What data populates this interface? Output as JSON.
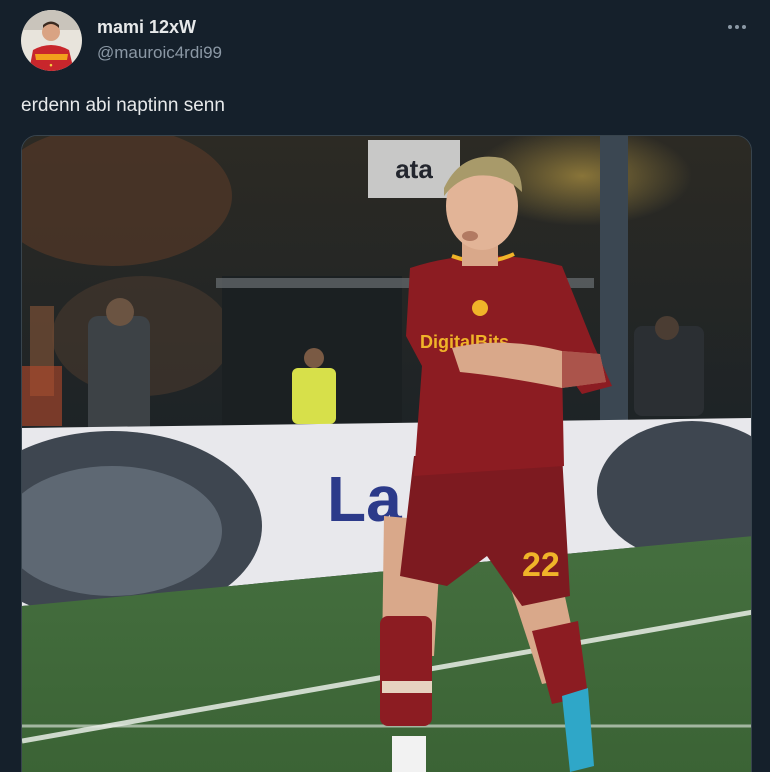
{
  "author": {
    "display_name": "mami 12xW",
    "handle": "@mauroic4rdi99",
    "avatar_icon": "profile-avatar"
  },
  "menu": {
    "more_icon": "more-horizontal-icon"
  },
  "tweet": {
    "text": "erdenn abi naptinn senn"
  },
  "media": {
    "type": "video",
    "player_number": "22",
    "sponsor_text": "DigitalBits",
    "board_text": "La",
    "stand_sign_text": "ata",
    "colors": {
      "kit": "#8c1c22",
      "kit_accent": "#f0b429",
      "pitch": "#3f6a3a",
      "board": "#e8e8ec"
    }
  }
}
